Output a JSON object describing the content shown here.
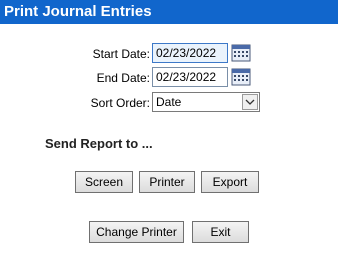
{
  "window": {
    "title": "Print Journal Entries"
  },
  "form": {
    "start_date": {
      "label": "Start Date:",
      "value": "02/23/2022"
    },
    "end_date": {
      "label": "End Date:",
      "value": "02/23/2022"
    },
    "sort_order": {
      "label": "Sort Order:",
      "value": "Date"
    }
  },
  "send_section": {
    "heading": "Send Report to ..."
  },
  "buttons": {
    "screen": "Screen",
    "printer": "Printer",
    "export": "Export",
    "change_printer": "Change Printer",
    "exit": "Exit"
  },
  "icons": {
    "calendar": "calendar-icon",
    "dropdown": "chevron-down-icon"
  }
}
